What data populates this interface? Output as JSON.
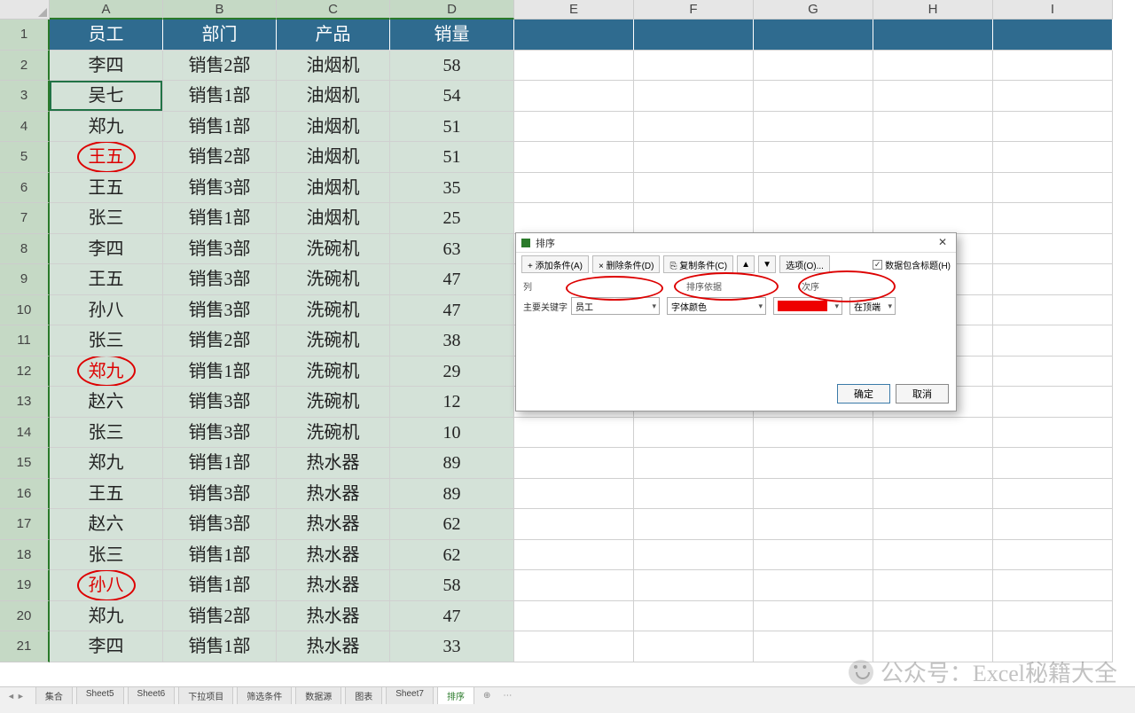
{
  "columns": [
    "A",
    "B",
    "C",
    "D",
    "E",
    "F",
    "G",
    "H",
    "I"
  ],
  "selected_columns": [
    "A",
    "B",
    "C",
    "D"
  ],
  "headers": {
    "A": "员工",
    "B": "部门",
    "C": "产品",
    "D": "销量"
  },
  "rows": [
    {
      "n": 2,
      "A": "李四",
      "B": "销售2部",
      "C": "油烟机",
      "D": "58",
      "red": false,
      "circle": false
    },
    {
      "n": 3,
      "A": "吴七",
      "B": "销售1部",
      "C": "油烟机",
      "D": "54",
      "red": false,
      "circle": false
    },
    {
      "n": 4,
      "A": "郑九",
      "B": "销售1部",
      "C": "油烟机",
      "D": "51",
      "red": false,
      "circle": false
    },
    {
      "n": 5,
      "A": "王五",
      "B": "销售2部",
      "C": "油烟机",
      "D": "51",
      "red": true,
      "circle": true
    },
    {
      "n": 6,
      "A": "王五",
      "B": "销售3部",
      "C": "油烟机",
      "D": "35",
      "red": false,
      "circle": false
    },
    {
      "n": 7,
      "A": "张三",
      "B": "销售1部",
      "C": "油烟机",
      "D": "25",
      "red": false,
      "circle": false
    },
    {
      "n": 8,
      "A": "李四",
      "B": "销售3部",
      "C": "洗碗机",
      "D": "63",
      "red": false,
      "circle": false
    },
    {
      "n": 9,
      "A": "王五",
      "B": "销售3部",
      "C": "洗碗机",
      "D": "47",
      "red": false,
      "circle": false
    },
    {
      "n": 10,
      "A": "孙八",
      "B": "销售3部",
      "C": "洗碗机",
      "D": "47",
      "red": false,
      "circle": false
    },
    {
      "n": 11,
      "A": "张三",
      "B": "销售2部",
      "C": "洗碗机",
      "D": "38",
      "red": false,
      "circle": false
    },
    {
      "n": 12,
      "A": "郑九",
      "B": "销售1部",
      "C": "洗碗机",
      "D": "29",
      "red": true,
      "circle": true
    },
    {
      "n": 13,
      "A": "赵六",
      "B": "销售3部",
      "C": "洗碗机",
      "D": "12",
      "red": false,
      "circle": false
    },
    {
      "n": 14,
      "A": "张三",
      "B": "销售3部",
      "C": "洗碗机",
      "D": "10",
      "red": false,
      "circle": false
    },
    {
      "n": 15,
      "A": "郑九",
      "B": "销售1部",
      "C": "热水器",
      "D": "89",
      "red": false,
      "circle": false
    },
    {
      "n": 16,
      "A": "王五",
      "B": "销售3部",
      "C": "热水器",
      "D": "89",
      "red": false,
      "circle": false
    },
    {
      "n": 17,
      "A": "赵六",
      "B": "销售3部",
      "C": "热水器",
      "D": "62",
      "red": false,
      "circle": false
    },
    {
      "n": 18,
      "A": "张三",
      "B": "销售1部",
      "C": "热水器",
      "D": "62",
      "red": false,
      "circle": false
    },
    {
      "n": 19,
      "A": "孙八",
      "B": "销售1部",
      "C": "热水器",
      "D": "58",
      "red": true,
      "circle": true
    },
    {
      "n": 20,
      "A": "郑九",
      "B": "销售2部",
      "C": "热水器",
      "D": "47",
      "red": false,
      "circle": false
    },
    {
      "n": 21,
      "A": "李四",
      "B": "销售1部",
      "C": "热水器",
      "D": "33",
      "red": false,
      "circle": false
    }
  ],
  "dialog": {
    "title": "排序",
    "add_btn": "+ 添加条件(A)",
    "del_btn": "× 删除条件(D)",
    "copy_btn": "⎘ 复制条件(C)",
    "options_btn": "选项(O)...",
    "header_check": "数据包含标题(H)",
    "grid_headers": {
      "col": "列",
      "sort": "排序依据",
      "order": "次序"
    },
    "row_label": "主要关键字",
    "col_value": "员工",
    "sort_value": "字体颜色",
    "order_value": "在顶端",
    "ok": "确定",
    "cancel": "取消"
  },
  "tabs": [
    "集合",
    "Sheet5",
    "Sheet6",
    "下拉项目",
    "筛选条件",
    "数据源",
    "图表",
    "Sheet7",
    "排序"
  ],
  "active_tab": "排序",
  "watermark": "公众号：Excel秘籍大全"
}
